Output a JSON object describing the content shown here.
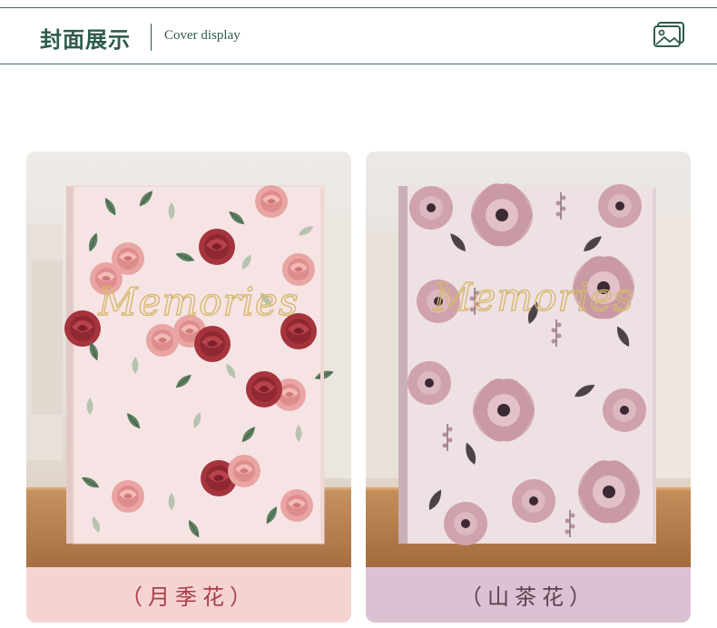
{
  "header": {
    "title_zh": "封面展示",
    "title_en": "Cover display",
    "gallery_icon": "image-gallery-icon"
  },
  "covers": [
    {
      "script_text": "Memories",
      "caption": "（月季花）",
      "accent": "#a8404a"
    },
    {
      "script_text": "Memories",
      "caption": "（山茶花）",
      "accent": "#5b4250"
    }
  ],
  "colors": {
    "brand_green": "#2f5b4f",
    "left_caption_bg": "#f4d3d1",
    "right_caption_bg": "#dbc2d2"
  }
}
